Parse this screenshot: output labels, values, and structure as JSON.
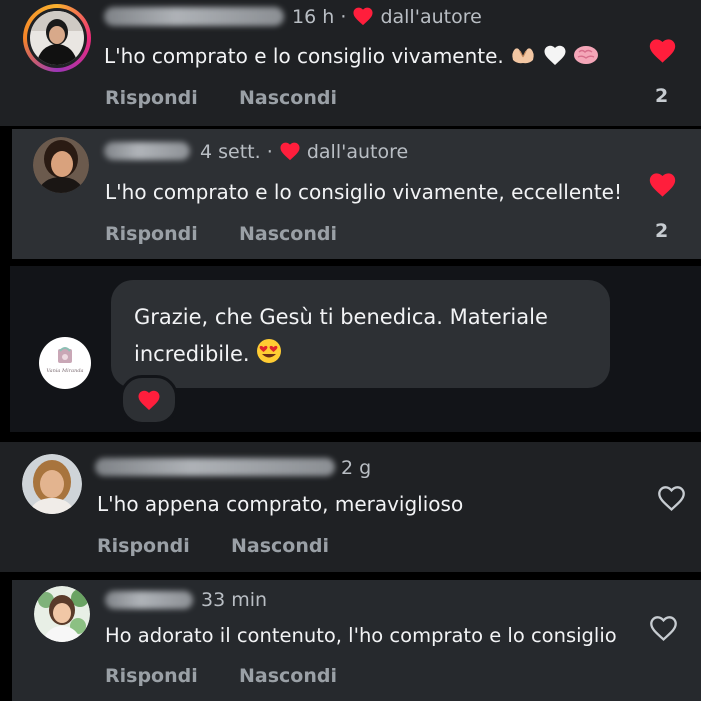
{
  "colors": {
    "heart": "#ff1e3c",
    "bg": "#000000"
  },
  "comments": [
    {
      "time": "16 h",
      "author_tag": "dall'autore",
      "text": "L'ho comprato e lo consiglio vivamente.",
      "emojis": [
        "heart-hands-icon",
        "white-heart-icon",
        "brain-icon"
      ],
      "reply_label": "Rispondi",
      "hide_label": "Nascondi",
      "likes": "2",
      "liked": true
    },
    {
      "time": "4 sett.",
      "author_tag": "dall'autore",
      "text": "L'ho comprato e lo consiglio vivamente, eccellente!",
      "reply_label": "Rispondi",
      "hide_label": "Nascondi",
      "likes": "2",
      "liked": true
    },
    {
      "text": "L'ho appena comprato, meraviglioso",
      "time": "2 g",
      "reply_label": "Rispondi",
      "hide_label": "Nascondi",
      "liked": false
    },
    {
      "time": "33 min",
      "text": "Ho adorato il contenuto, l'ho comprato e lo consiglio",
      "reply_label": "Rispondi",
      "hide_label": "Nascondi",
      "liked": false
    }
  ],
  "reply": {
    "line1": "Grazie, che Gesù ti benedica. Materiale",
    "line2": "incredibile.",
    "emoji": "heart-eyes-icon",
    "reaction": "heart-icon",
    "logo_text": "Vania Miranda"
  }
}
